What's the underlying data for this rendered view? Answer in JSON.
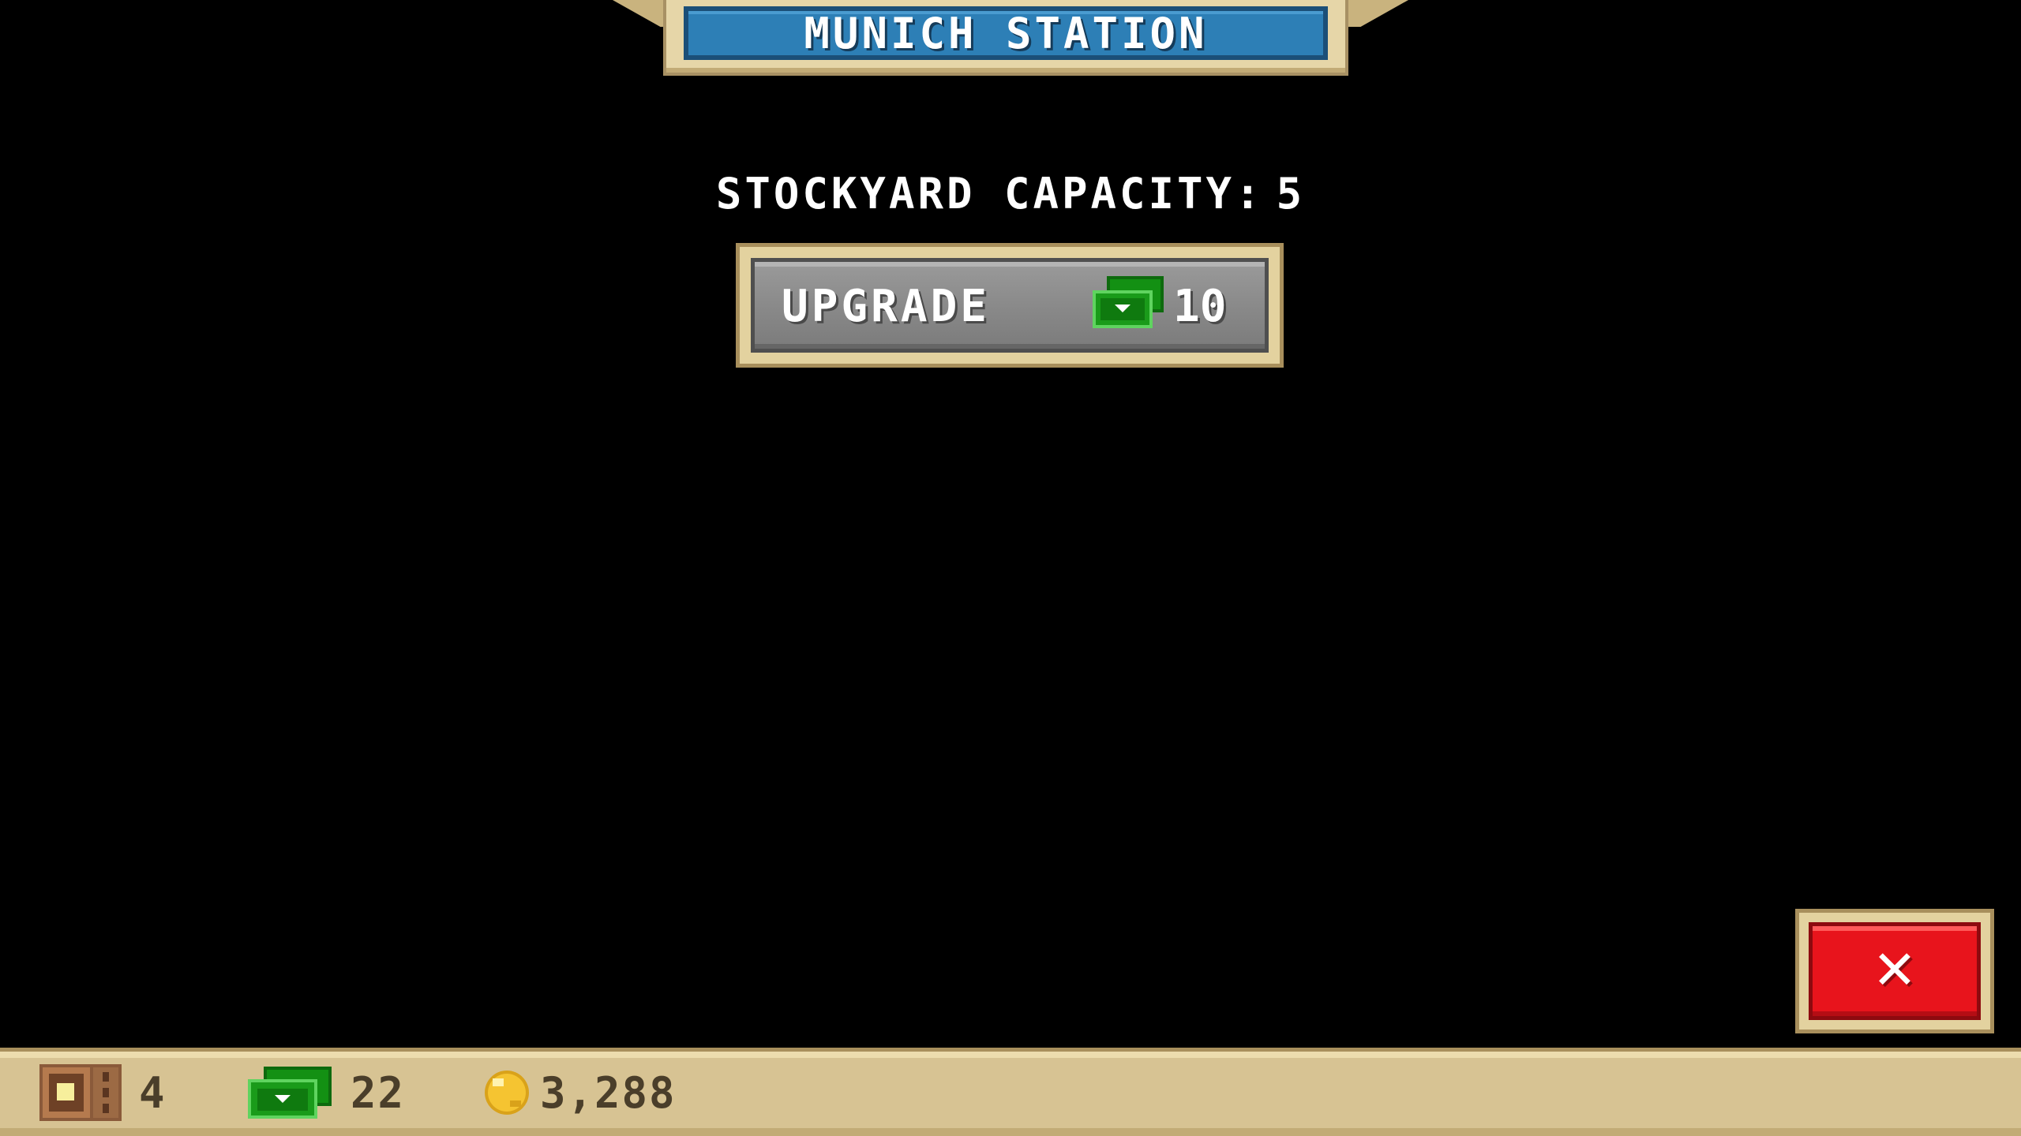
{
  "title": "MUNICH STATION",
  "stockyard": {
    "capacity_label": "STOCKYARD CAPACITY:",
    "capacity_value": "5"
  },
  "upgrade": {
    "label": "UPGRADE",
    "cost": "10",
    "cost_icon": "cash-icon"
  },
  "close": {
    "icon": "close-icon",
    "glyph": "✕"
  },
  "status_bar": {
    "stockyard_count": "4",
    "stockyard_icon": "stockyard-icon",
    "cash": "22",
    "cash_icon": "cash-icon",
    "coins": "3,288",
    "coin_icon": "coin-icon"
  },
  "colors": {
    "title_banner": "#2d7fb6",
    "frame_gold": "#e3d29f",
    "button_gray": "#8a8a8a",
    "close_red": "#e8141c",
    "cash_green": "#1a9b1a",
    "coin_yellow": "#f5c431"
  }
}
